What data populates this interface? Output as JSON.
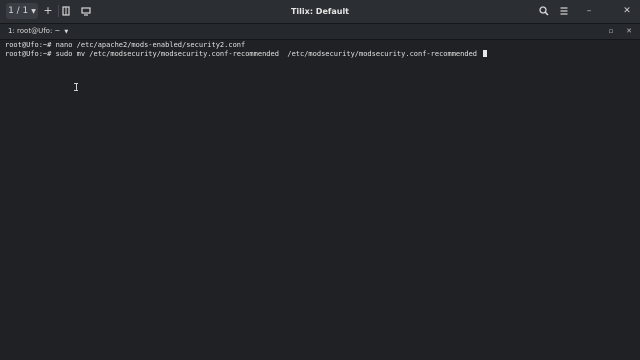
{
  "window": {
    "title": "Tilix: Default",
    "session_counter": "1 / 1",
    "add_session_label": "+",
    "icons": {
      "add_terminal_right": "add-terminal-right-icon",
      "new_window": "new-window-icon",
      "search": "search-icon",
      "menu": "hamburger-menu-icon",
      "minimize": "minimize-icon",
      "close": "close-icon"
    }
  },
  "terminal": {
    "tab_title": "1: root@Ufo: ~",
    "lines": [
      "root@Ufo:~# nano /etc/apache2/mods-enabled/security2.conf",
      "root@Ufo:~# sudo mv /etc/modsecurity/modsecurity.conf-recommended  /etc/modsecurity/modsecurity.conf-recommended "
    ]
  },
  "colors": {
    "headerbar": "#2b2e33",
    "terminal_background": "#1f2124",
    "foreground": "#e2e2e2"
  }
}
